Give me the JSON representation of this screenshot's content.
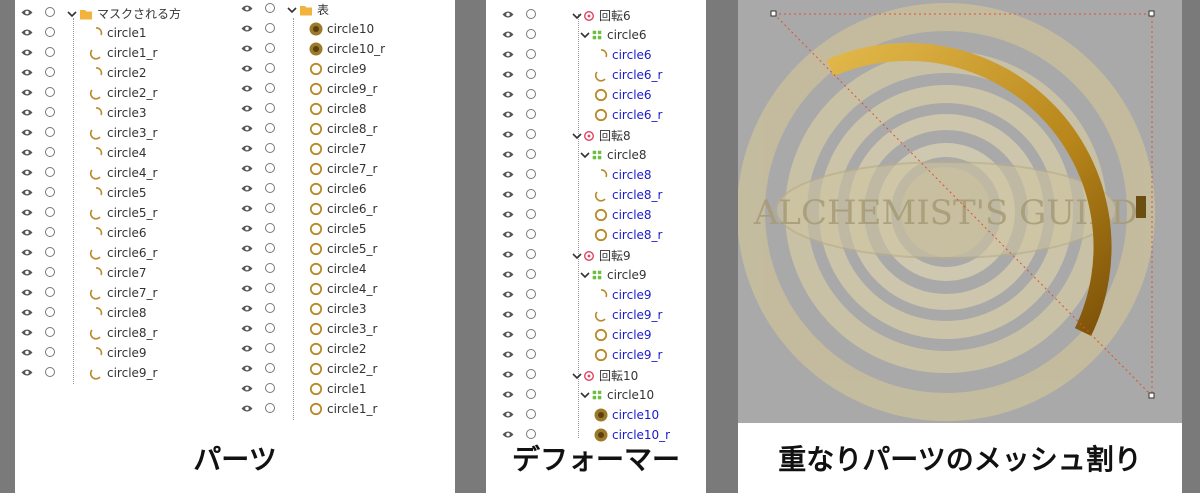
{
  "panel1": {
    "caption": "パーツ",
    "folder_left": "マスクされる方",
    "folder_right": "表",
    "left_items": [
      "circle1",
      "circle1_r",
      "circle2",
      "circle2_r",
      "circle3",
      "circle3_r",
      "circle4",
      "circle4_r",
      "circle5",
      "circle5_r",
      "circle6",
      "circle6_r",
      "circle7",
      "circle7_r",
      "circle8",
      "circle8_r",
      "circle9",
      "circle9_r"
    ],
    "right_items": [
      "circle10",
      "circle10_r",
      "circle9",
      "circle9_r",
      "circle8",
      "circle8_r",
      "circle7",
      "circle7_r",
      "circle6",
      "circle6_r",
      "circle5",
      "circle5_r",
      "circle4",
      "circle4_r",
      "circle3",
      "circle3_r",
      "circle2",
      "circle2_r",
      "circle1",
      "circle1_r"
    ]
  },
  "panel2": {
    "caption": "デフォーマー",
    "groups": [
      {
        "rotation": "回転6",
        "warp": "circle6",
        "items": [
          "circle6",
          "circle6_r",
          "circle6",
          "circle6_r"
        ]
      },
      {
        "rotation": "回転8",
        "warp": "circle8",
        "items": [
          "circle8",
          "circle8_r",
          "circle8",
          "circle8_r"
        ]
      },
      {
        "rotation": "回転9",
        "warp": "circle9",
        "items": [
          "circle9",
          "circle9_r",
          "circle9",
          "circle9_r"
        ]
      },
      {
        "rotation": "回転10",
        "warp": "circle10",
        "items": [
          "circle10",
          "circle10_r"
        ]
      }
    ]
  },
  "panel3": {
    "caption": "重なりパーツのメッシュ割り",
    "logo_text": "ALCHEMIST'S GUILD"
  }
}
